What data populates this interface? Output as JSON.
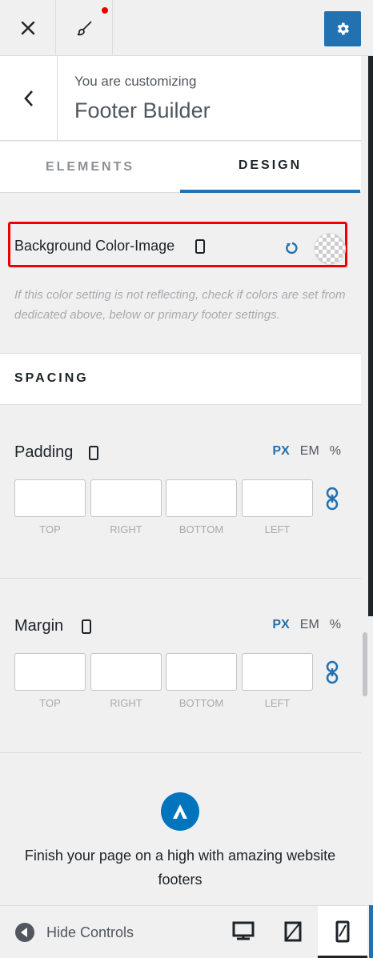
{
  "topbar": {
    "close_icon": "close-icon",
    "brush_icon": "paintbrush-icon",
    "settings_icon": "gear-icon",
    "accent": "#2271b1"
  },
  "header": {
    "sub_label": "You are customizing",
    "title": "Footer Builder"
  },
  "tabs": [
    {
      "label": "ELEMENTS",
      "active": false
    },
    {
      "label": "DESIGN",
      "active": true
    }
  ],
  "background": {
    "label": "Background Color-Image",
    "note": "If this color setting is not reflecting, check if colors are set from dedicated above, below or primary footer settings."
  },
  "spacing": {
    "title": "SPACING",
    "padding": {
      "label": "Padding",
      "units": [
        "PX",
        "EM",
        "%"
      ],
      "active_unit": "PX",
      "fields": [
        "TOP",
        "RIGHT",
        "BOTTOM",
        "LEFT"
      ]
    },
    "margin": {
      "label": "Margin",
      "units": [
        "PX",
        "EM",
        "%"
      ],
      "active_unit": "PX",
      "fields": [
        "TOP",
        "RIGHT",
        "BOTTOM",
        "LEFT"
      ]
    }
  },
  "promo": {
    "text": "Finish your page on a high with amazing website footers"
  },
  "footer": {
    "hide_controls": "Hide Controls"
  }
}
